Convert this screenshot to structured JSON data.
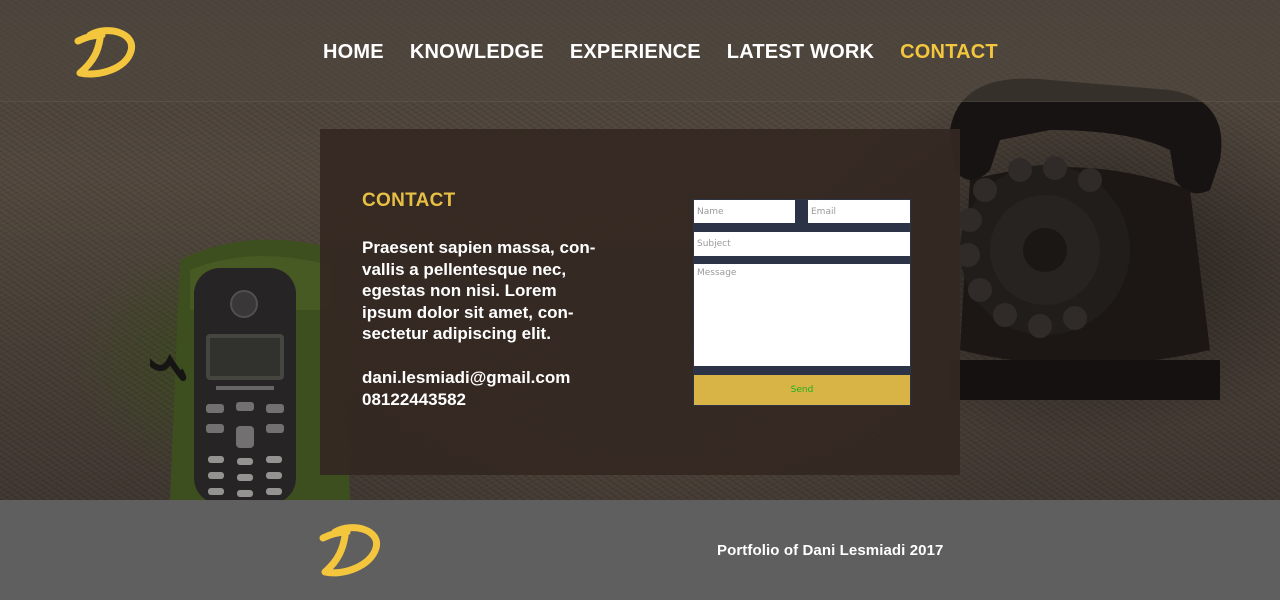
{
  "brand": {
    "accent": "#f4c63d",
    "logo_icon": "d-letter-logo-icon"
  },
  "nav": {
    "items": [
      {
        "label": "HOME",
        "active": false
      },
      {
        "label": "KNOWLEDGE",
        "active": false
      },
      {
        "label": "EXPERIENCE",
        "active": false
      },
      {
        "label": "LATEST WORK",
        "active": false
      },
      {
        "label": "CONTACT",
        "active": true
      }
    ]
  },
  "contact": {
    "title": "CONTACT",
    "text_lines": [
      "Praesent sapien massa, con-",
      "vallis a pellentesque nec,",
      "egestas non nisi. Lorem",
      "ipsum dolor sit amet, con-",
      "sectetur adipiscing elit."
    ],
    "email": "dani.lesmiadi@gmail.com",
    "phone": "08122443582"
  },
  "form": {
    "name_placeholder": "Name",
    "email_placeholder": "Email",
    "subject_placeholder": "Subject",
    "message_placeholder": "Message",
    "send_label": "Send",
    "colors": {
      "frame": "#2d3347",
      "send_bg": "#d8b346",
      "send_text": "#1fb01f"
    }
  },
  "footer": {
    "text": "Portfolio of Dani Lesmiadi 2017",
    "background": "#5f5f5f"
  },
  "background": {
    "description_icon": "telephones-photo"
  }
}
